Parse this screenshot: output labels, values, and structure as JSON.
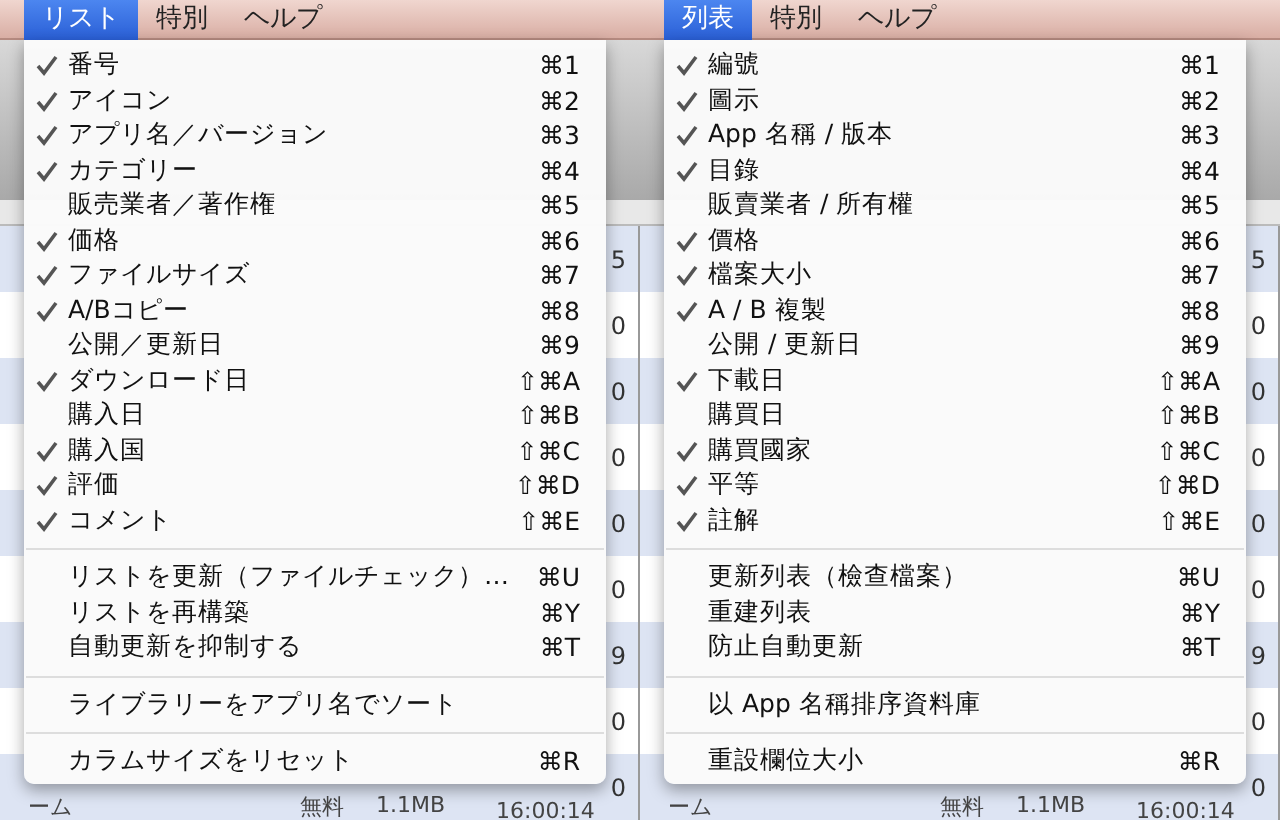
{
  "panes": [
    {
      "menubar": {
        "items": [
          {
            "label": "リスト",
            "selected": true
          },
          {
            "label": "特別",
            "selected": false
          },
          {
            "label": "ヘルプ",
            "selected": false
          }
        ]
      },
      "menu": {
        "sections": [
          [
            {
              "label": "番号",
              "shortcut": "⌘1",
              "checked": true
            },
            {
              "label": "アイコン",
              "shortcut": "⌘2",
              "checked": true
            },
            {
              "label": "アプリ名／バージョン",
              "shortcut": "⌘3",
              "checked": true
            },
            {
              "label": "カテゴリー",
              "shortcut": "⌘4",
              "checked": true
            },
            {
              "label": "販売業者／著作権",
              "shortcut": "⌘5",
              "checked": false
            },
            {
              "label": "価格",
              "shortcut": "⌘6",
              "checked": true
            },
            {
              "label": "ファイルサイズ",
              "shortcut": "⌘7",
              "checked": true
            },
            {
              "label": "A/Bコピー",
              "shortcut": "⌘8",
              "checked": true
            },
            {
              "label": "公開／更新日",
              "shortcut": "⌘9",
              "checked": false
            },
            {
              "label": "ダウンロード日",
              "shortcut": "⇧⌘A",
              "checked": true
            },
            {
              "label": "購入日",
              "shortcut": "⇧⌘B",
              "checked": false
            },
            {
              "label": "購入国",
              "shortcut": "⇧⌘C",
              "checked": true
            },
            {
              "label": "評価",
              "shortcut": "⇧⌘D",
              "checked": true
            },
            {
              "label": "コメント",
              "shortcut": "⇧⌘E",
              "checked": true
            }
          ],
          [
            {
              "label": "リストを更新（ファイルチェック）…",
              "shortcut": "⌘U",
              "checked": false
            },
            {
              "label": "リストを再構築",
              "shortcut": "⌘Y",
              "checked": false
            },
            {
              "label": "自動更新を抑制する",
              "shortcut": "⌘T",
              "checked": false
            }
          ],
          [
            {
              "label": "ライブラリーをアプリ名でソート",
              "checked": false
            }
          ],
          [
            {
              "label": "カラムサイズをリセット",
              "shortcut": "⌘R",
              "checked": false
            }
          ]
        ]
      },
      "background": {
        "edge_cells": [
          "5",
          "0",
          "0",
          "0",
          "0",
          "0",
          "9",
          "0",
          "0"
        ],
        "bottom_row": {
          "category": "ーム",
          "price": "無料",
          "size": "1.1MB",
          "time": "16:00:14"
        }
      }
    },
    {
      "menubar": {
        "items": [
          {
            "label": "列表",
            "selected": true
          },
          {
            "label": "特別",
            "selected": false
          },
          {
            "label": "ヘルプ",
            "selected": false
          }
        ]
      },
      "menu": {
        "sections": [
          [
            {
              "label": "編號",
              "shortcut": "⌘1",
              "checked": true
            },
            {
              "label": "圖示",
              "shortcut": "⌘2",
              "checked": true
            },
            {
              "label": "App 名稱 / 版本",
              "shortcut": "⌘3",
              "checked": true
            },
            {
              "label": "目錄",
              "shortcut": "⌘4",
              "checked": true
            },
            {
              "label": "販賣業者 / 所有權",
              "shortcut": "⌘5",
              "checked": false
            },
            {
              "label": "價格",
              "shortcut": "⌘6",
              "checked": true
            },
            {
              "label": "檔案大小",
              "shortcut": "⌘7",
              "checked": true
            },
            {
              "label": "A / B 複製",
              "shortcut": "⌘8",
              "checked": true
            },
            {
              "label": "公開 / 更新日",
              "shortcut": "⌘9",
              "checked": false
            },
            {
              "label": "下載日",
              "shortcut": "⇧⌘A",
              "checked": true
            },
            {
              "label": "購買日",
              "shortcut": "⇧⌘B",
              "checked": false
            },
            {
              "label": "購買國家",
              "shortcut": "⇧⌘C",
              "checked": true
            },
            {
              "label": "平等",
              "shortcut": "⇧⌘D",
              "checked": true
            },
            {
              "label": "註解",
              "shortcut": "⇧⌘E",
              "checked": true
            }
          ],
          [
            {
              "label": "更新列表（檢查檔案）",
              "shortcut": "⌘U",
              "checked": false
            },
            {
              "label": "重建列表",
              "shortcut": "⌘Y",
              "checked": false
            },
            {
              "label": "防止自動更新",
              "shortcut": "⌘T",
              "checked": false
            }
          ],
          [
            {
              "label": "以 App 名稱排序資料庫",
              "checked": false
            }
          ],
          [
            {
              "label": "重設欄位大小",
              "shortcut": "⌘R",
              "checked": false
            }
          ]
        ]
      },
      "background": {
        "edge_cells": [
          "5",
          "0",
          "0",
          "0",
          "0",
          "0",
          "9",
          "0",
          "0"
        ],
        "bottom_row": {
          "category": "ーム",
          "price": "無料",
          "size": "1.1MB",
          "time": "16:00:14"
        }
      }
    }
  ]
}
